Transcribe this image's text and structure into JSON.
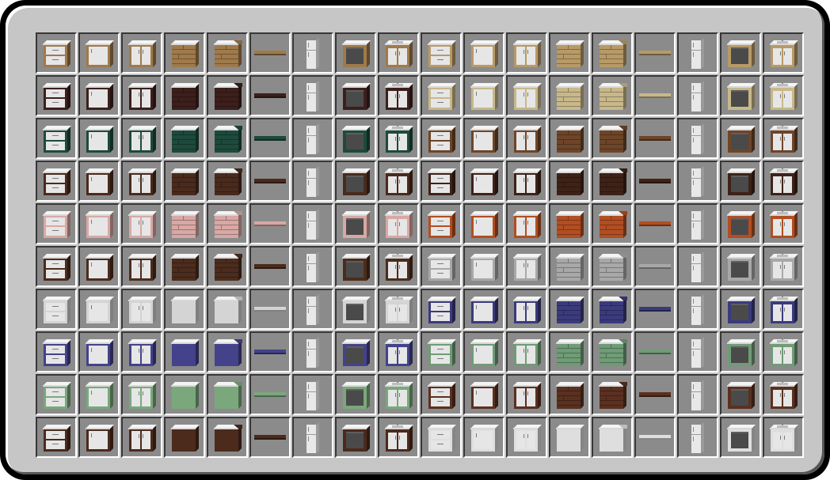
{
  "inventory": {
    "columns": 18,
    "rows": [
      [
        "oak-drawer-cabinet",
        "oak-cabinet",
        "oak-double-door-cabinet",
        "oak-plank-cabinet",
        "oak-plank-corner-cabinet",
        "oak-shelf",
        "fridge",
        "oak-oven",
        "oak-sink-cabinet",
        "birch-drawer-cabinet",
        "birch-cabinet",
        "birch-double-door-cabinet",
        "birch-plank-cabinet",
        "birch-plank-corner-cabinet",
        "birch-shelf",
        "fridge",
        "birch-oven",
        "birch-sink-cabinet"
      ],
      [
        "dark-oak-drawer-cabinet",
        "dark-oak-cabinet",
        "dark-oak-double-door-cabinet",
        "dark-oak-plank-cabinet",
        "dark-oak-plank-corner-cabinet",
        "dark-oak-shelf",
        "fridge",
        "dark-oak-oven",
        "dark-oak-sink-cabinet",
        "sandstone-drawer-cabinet",
        "sandstone-cabinet",
        "sandstone-double-door-cabinet",
        "sandstone-plank-cabinet",
        "sandstone-plank-corner-cabinet",
        "sandstone-shelf",
        "fridge",
        "sandstone-oven",
        "sandstone-sink-cabinet"
      ],
      [
        "green-drawer-cabinet",
        "green-cabinet",
        "green-double-door-cabinet",
        "green-plank-cabinet",
        "green-plank-corner-cabinet",
        "green-shelf",
        "fridge",
        "green-oven",
        "green-sink-cabinet",
        "spruce-drawer-cabinet",
        "spruce-cabinet",
        "spruce-double-door-cabinet",
        "spruce-plank-cabinet",
        "spruce-plank-corner-cabinet",
        "spruce-shelf",
        "fridge",
        "spruce-oven",
        "spruce-sink-cabinet"
      ],
      [
        "jungle-drawer-cabinet",
        "jungle-cabinet",
        "jungle-double-door-cabinet",
        "jungle-plank-cabinet",
        "jungle-plank-corner-cabinet",
        "jungle-shelf",
        "fridge",
        "jungle-oven",
        "jungle-sink-cabinet",
        "walnut-drawer-cabinet",
        "walnut-cabinet",
        "walnut-double-door-cabinet",
        "walnut-plank-cabinet",
        "walnut-plank-corner-cabinet",
        "walnut-shelf",
        "fridge",
        "walnut-oven",
        "walnut-sink-cabinet"
      ],
      [
        "pink-drawer-cabinet",
        "pink-cabinet",
        "pink-double-door-cabinet",
        "pink-plank-cabinet",
        "pink-plank-corner-cabinet",
        "pink-shelf",
        "fridge",
        "pink-oven",
        "pink-sink-cabinet",
        "acacia-drawer-cabinet",
        "acacia-cabinet",
        "acacia-double-door-cabinet",
        "acacia-plank-cabinet",
        "acacia-plank-corner-cabinet",
        "acacia-shelf",
        "fridge",
        "acacia-oven",
        "acacia-sink-cabinet"
      ],
      [
        "mahogany-drawer-cabinet",
        "mahogany-cabinet",
        "mahogany-double-door-cabinet",
        "mahogany-plank-cabinet",
        "mahogany-plank-corner-cabinet",
        "mahogany-shelf",
        "fridge",
        "mahogany-oven",
        "mahogany-sink-cabinet",
        "stone-drawer-cabinet",
        "stone-cabinet",
        "stone-double-door-cabinet",
        "stone-brick-cabinet",
        "stone-brick-corner-cabinet",
        "stone-shelf",
        "fridge",
        "stone-oven",
        "stone-sink-cabinet"
      ],
      [
        "white-drawer-cabinet",
        "white-cabinet",
        "white-double-door-cabinet",
        "white-plain-cabinet",
        "white-plain-corner-cabinet",
        "white-shelf",
        "fridge",
        "white-oven",
        "white-sink-cabinet",
        "navy-drawer-cabinet",
        "navy-cabinet",
        "navy-double-door-cabinet",
        "navy-brick-cabinet",
        "navy-brick-corner-cabinet",
        "navy-shelf",
        "fridge",
        "navy-oven",
        "navy-sink-cabinet"
      ],
      [
        "purple-drawer-cabinet",
        "purple-cabinet",
        "purple-double-door-cabinet",
        "purple-plain-cabinet",
        "purple-plain-corner-cabinet",
        "purple-shelf",
        "fridge",
        "purple-oven",
        "purple-sink-cabinet",
        "mint-drawer-cabinet",
        "mint-cabinet",
        "mint-double-door-cabinet",
        "mint-plank-cabinet",
        "mint-plank-corner-cabinet",
        "mint-shelf",
        "fridge",
        "mint-oven",
        "mint-sink-cabinet"
      ],
      [
        "sage-drawer-cabinet",
        "sage-cabinet",
        "sage-double-door-cabinet",
        "sage-plain-cabinet",
        "sage-plain-corner-cabinet",
        "sage-shelf",
        "fridge",
        "sage-oven",
        "sage-sink-cabinet",
        "brown-drawer-cabinet",
        "brown-cabinet",
        "brown-double-door-cabinet",
        "brown-plank-cabinet",
        "brown-plank-corner-cabinet",
        "brown-shelf",
        "fridge",
        "brown-oven",
        "brown-sink-cabinet"
      ],
      [
        "cherry-drawer-cabinet",
        "cherry-cabinet",
        "cherry-double-door-cabinet",
        "cherry-plain-cabinet",
        "cherry-plain-corner-cabinet",
        "cherry-shelf",
        "fridge",
        "cherry-oven",
        "cherry-sink-cabinet",
        "quartz-drawer-cabinet",
        "quartz-cabinet",
        "quartz-double-door-cabinet",
        "quartz-plain-cabinet",
        "quartz-plain-corner-cabinet",
        "quartz-shelf",
        "fridge",
        "quartz-oven",
        "quartz-sink-cabinet"
      ]
    ]
  },
  "colors": {
    "oak": "#a07a4a",
    "birch": "#b89a66",
    "dark-oak": "#3c1f1c",
    "sandstone": "#c8b88a",
    "green": "#1d4a3c",
    "spruce": "#6e4528",
    "jungle": "#4a2a1c",
    "walnut": "#3e2218",
    "pink": "#d8a8a4",
    "acacia": "#b24e22",
    "mahogany": "#4b2c1d",
    "stone": "#a8a8a8",
    "white": "#d4d4d4",
    "navy": "#3b3a7c",
    "purple": "#44428a",
    "mint": "#6f9c76",
    "sage": "#7aa87c",
    "brown": "#5a3020",
    "cherry": "#4c2a1c",
    "quartz": "#dedede",
    "countertop": "#f4f4f4",
    "door-panel": "#e6e6e6",
    "oven-window": "#4a4a4a",
    "fridge": "#e8e8e8"
  }
}
